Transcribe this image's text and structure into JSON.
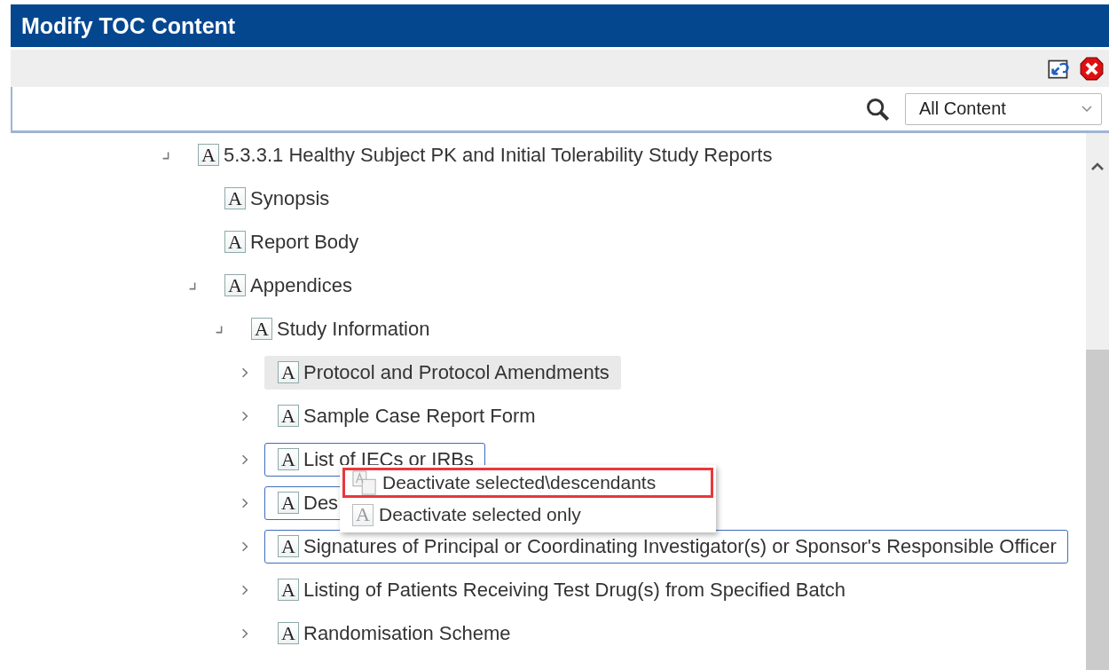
{
  "window": {
    "title": "Modify TOC Content"
  },
  "search": {
    "filter": "All Content"
  },
  "tree": [
    {
      "label": "5.3.3.1 Healthy Subject PK and Initial Tolerability Study Reports",
      "icon": "A",
      "expandable": true,
      "expanded": true,
      "selected": false,
      "highlighted": false,
      "children": [
        {
          "label": "Synopsis",
          "icon": "A",
          "expandable": false,
          "selected": false,
          "highlighted": false
        },
        {
          "label": "Report Body",
          "icon": "A",
          "expandable": false,
          "selected": false,
          "highlighted": false
        },
        {
          "label": "Appendices",
          "icon": "A",
          "expandable": true,
          "expanded": true,
          "selected": false,
          "highlighted": false,
          "children": [
            {
              "label": "Study Information",
              "icon": "A",
              "expandable": true,
              "expanded": true,
              "selected": false,
              "highlighted": false,
              "children": [
                {
                  "label": "Protocol and Protocol Amendments",
                  "icon": "A",
                  "expandable": true,
                  "expanded": false,
                  "selected": false,
                  "highlighted": true
                },
                {
                  "label": "Sample Case Report Form",
                  "icon": "A",
                  "expandable": true,
                  "expanded": false,
                  "selected": false,
                  "highlighted": false
                },
                {
                  "label": "List of IECs or IRBs",
                  "icon": "A",
                  "expandable": true,
                  "expanded": false,
                  "selected": true,
                  "highlighted": false
                },
                {
                  "label": "Des",
                  "icon": "A",
                  "expandable": true,
                  "expanded": false,
                  "selected": true,
                  "highlighted": false
                },
                {
                  "label": "Signatures of Principal or Coordinating Investigator(s) or Sponsor's Responsible Officer",
                  "icon": "A",
                  "expandable": true,
                  "expanded": false,
                  "selected": true,
                  "highlighted": false
                },
                {
                  "label": "Listing of Patients Receiving Test Drug(s) from Specified Batch",
                  "icon": "A",
                  "expandable": true,
                  "expanded": false,
                  "selected": false,
                  "highlighted": false
                },
                {
                  "label": "Randomisation Scheme",
                  "icon": "A",
                  "expandable": true,
                  "expanded": false,
                  "selected": false,
                  "highlighted": false
                }
              ]
            }
          ]
        }
      ]
    }
  ],
  "context_menu": [
    {
      "label": "Deactivate selected\\descendants",
      "kind": "descendants",
      "selected": true
    },
    {
      "label": "Deactivate selected only",
      "kind": "single",
      "icon": "A",
      "selected": false
    }
  ]
}
